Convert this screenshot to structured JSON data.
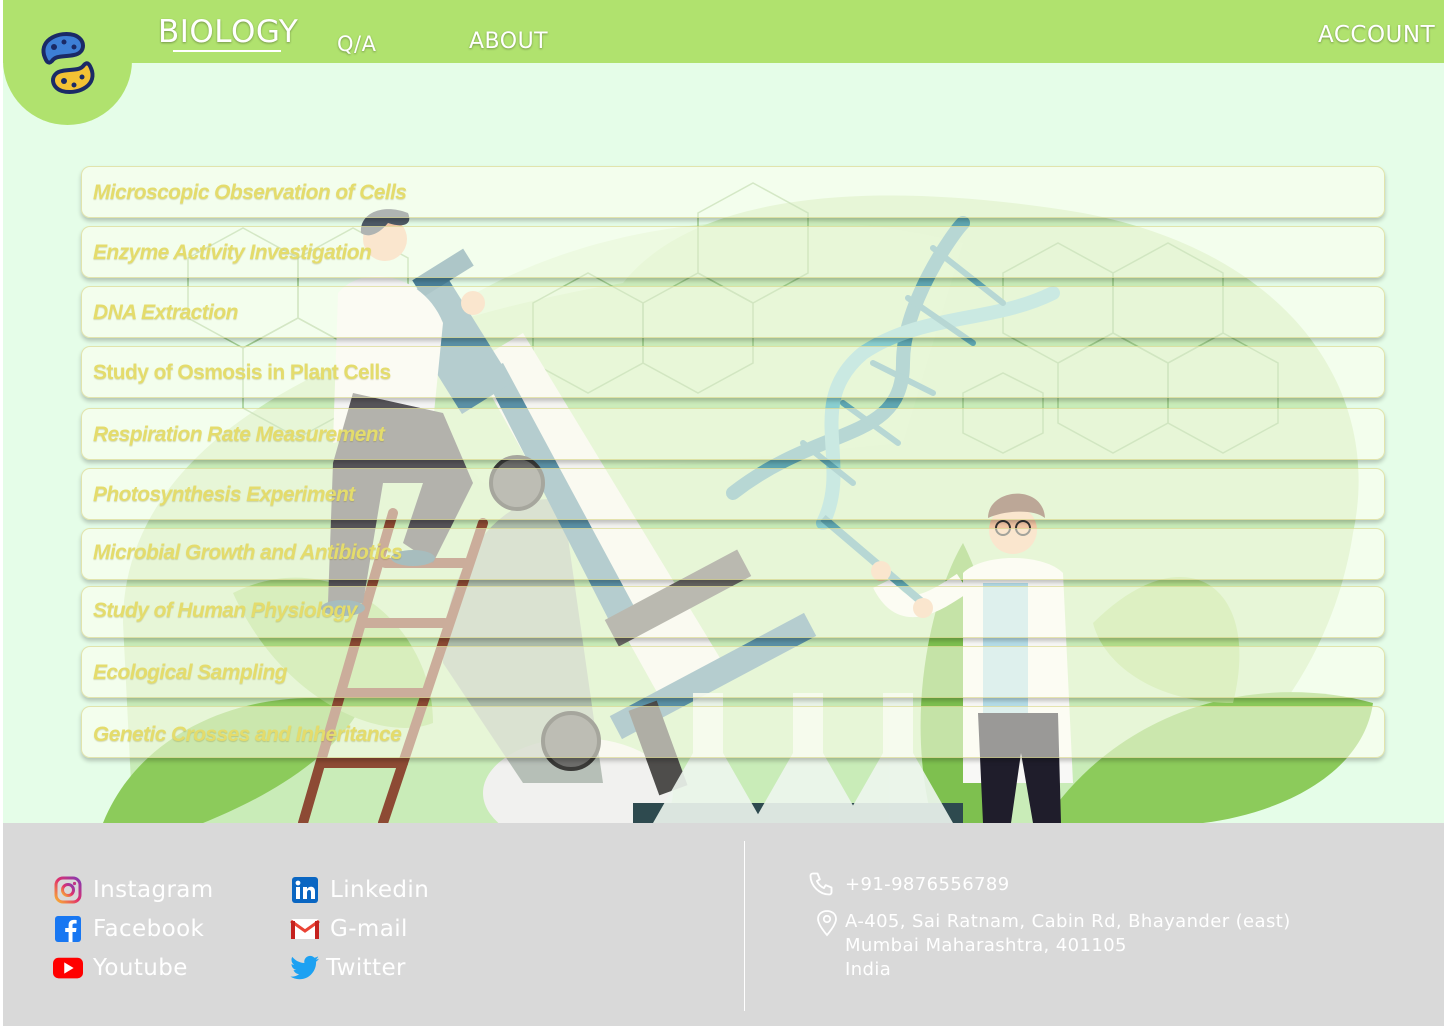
{
  "nav": {
    "brand": "BIOLOGY",
    "qa": "Q/A",
    "about": "ABOUT",
    "account": "ACCOUNT"
  },
  "experiments": [
    {
      "label": "Microscopic Observation of Cells"
    },
    {
      "label": "Enzyme Activity Investigation"
    },
    {
      "label": "DNA Extraction"
    },
    {
      "label": "Study of Osmosis in Plant Cells"
    },
    {
      "label": "Respiration Rate Measurement"
    },
    {
      "label": "Photosynthesis Experiment"
    },
    {
      "label": "Microbial Growth and Antibiotics"
    },
    {
      "label": "Study of Human Physiology"
    },
    {
      "label": "Ecological Sampling"
    },
    {
      "label": "Genetic Crosses and Inheritance"
    }
  ],
  "footer": {
    "social": {
      "instagram": "Instagram",
      "facebook": "Facebook",
      "youtube": "Youtube",
      "linkedin": "Linkedin",
      "gmail": "G-mail",
      "twitter": "Twitter"
    },
    "phone": "+91-9876556789",
    "address": {
      "line1": "A-405, Sai Ratnam, Cabin Rd, Bhayander (east)",
      "line2": "Mumbai Maharashtra, 401105",
      "line3": "India"
    }
  },
  "icons": [
    "logo-bacteria-icon",
    "instagram-icon",
    "facebook-icon",
    "youtube-icon",
    "linkedin-icon",
    "gmail-icon",
    "twitter-icon",
    "phone-icon",
    "location-pin-icon"
  ],
  "colors": {
    "topbar": "#b0e26e",
    "page_bg": "#e5fde8",
    "footer_bg": "#d9d9d9",
    "item_text": "#e4dc6c"
  }
}
